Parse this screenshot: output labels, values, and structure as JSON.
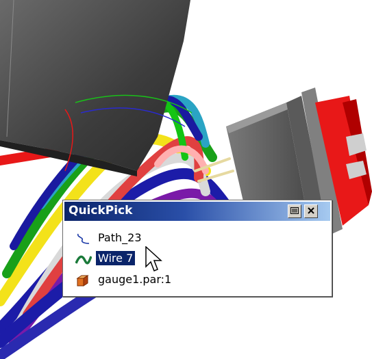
{
  "quickpick": {
    "title": "QuickPick",
    "menu_icon": "list-icon",
    "close_icon": "close-icon",
    "items": [
      {
        "label": "Path_23",
        "icon": "path-curve-icon",
        "selected": false
      },
      {
        "label": "Wire 7",
        "icon": "wire-icon",
        "selected": true
      },
      {
        "label": "gauge1.par:1",
        "icon": "part-cube-icon",
        "selected": false
      }
    ]
  },
  "colors": {
    "title_start": "#0b246a",
    "title_end": "#a6caf0",
    "selection": "#0a246a",
    "connector_red": "#e81818",
    "housing": "#4a4a4a"
  },
  "cursor": {
    "icon": "arrow-cursor-icon"
  }
}
